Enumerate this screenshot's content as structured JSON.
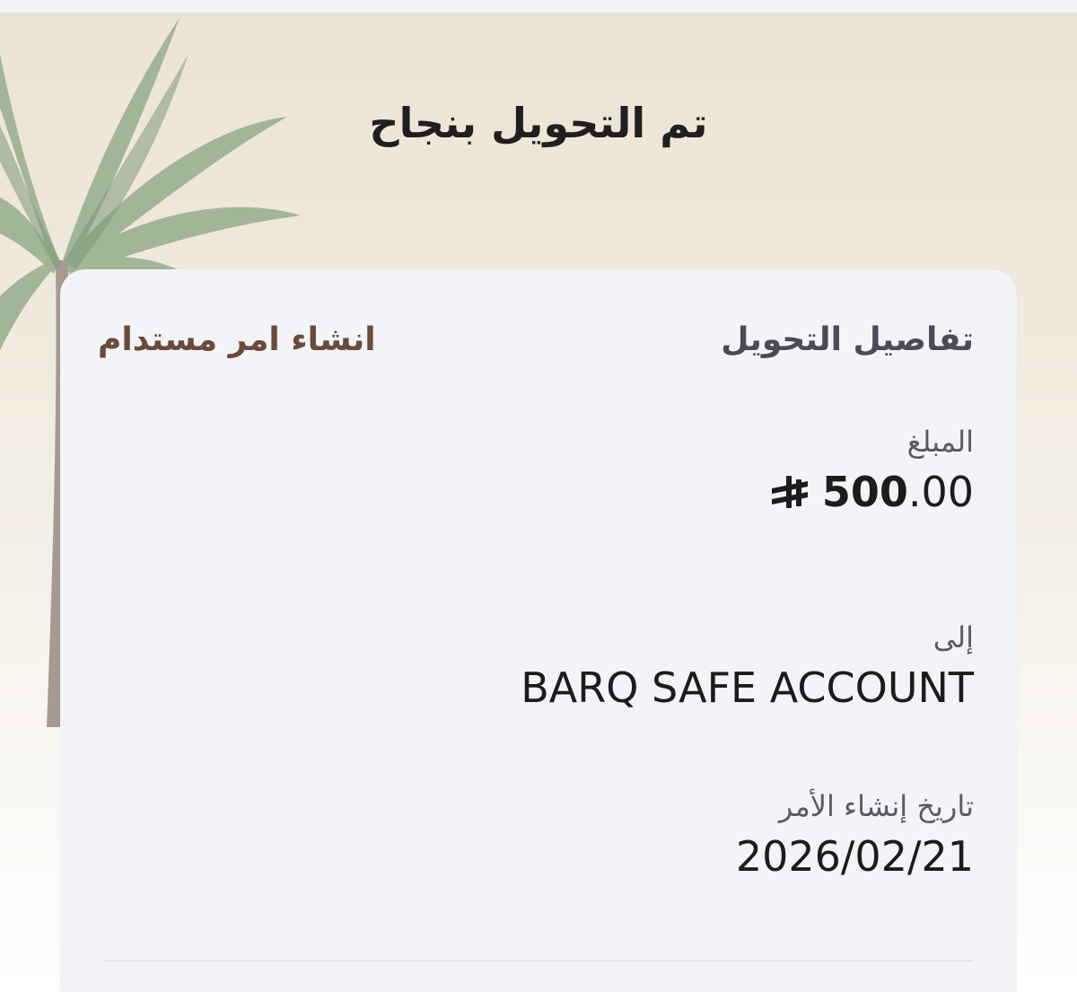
{
  "page": {
    "title": "تم التحويل بنجاح"
  },
  "details": {
    "section_title": "تفاصيل التحويل",
    "standing_order_link": "انشاء امر مستدام",
    "amount": {
      "label": "المبلغ",
      "integer": "500",
      "decimal": ".00",
      "currency_icon": "saudi-riyal-icon"
    },
    "recipient": {
      "label": "إلى",
      "value": "BARQ SAFE ACCOUNT"
    },
    "order_date": {
      "label": "تاريخ إنشاء الأمر",
      "value": "2026/02/21"
    }
  },
  "colors": {
    "link": "#6a4a3a",
    "card_bg": "#f3f4f8",
    "palm_leaf": "#8fa687"
  }
}
